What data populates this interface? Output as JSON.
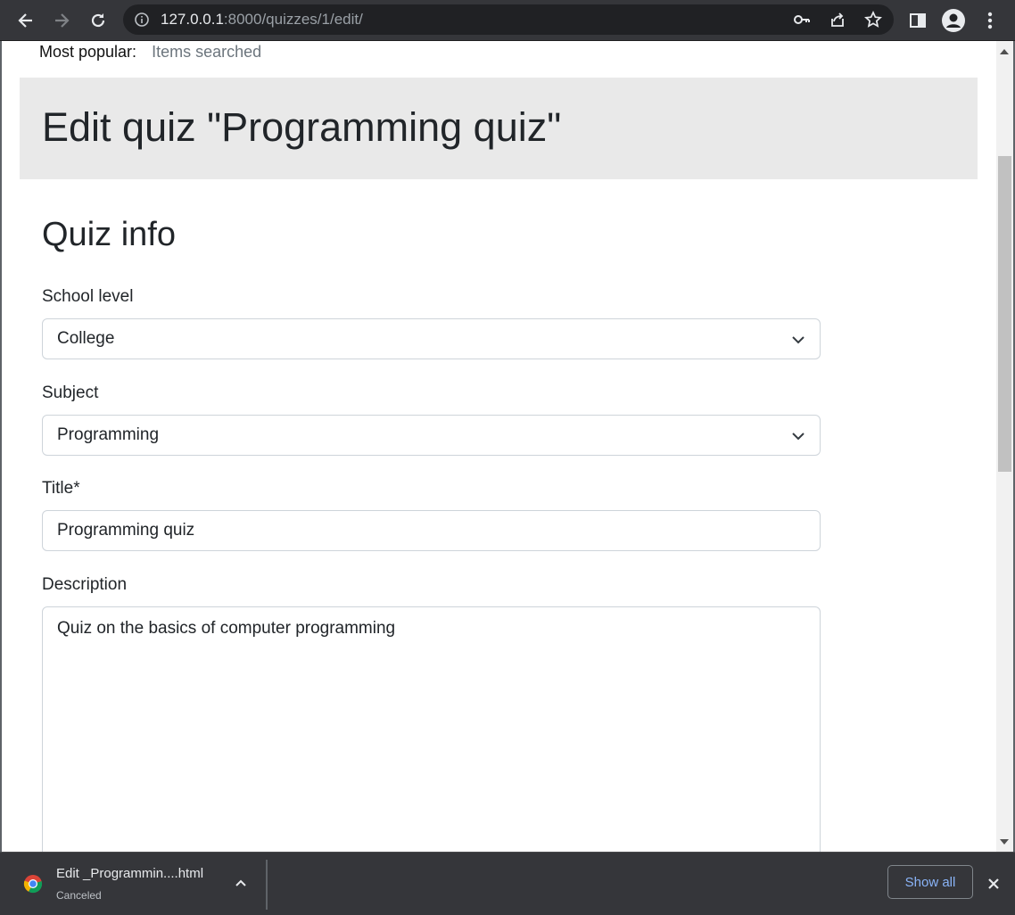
{
  "browser": {
    "url_host": "127.0.0.1",
    "url_rest": ":8000/quizzes/1/edit/"
  },
  "page": {
    "popular_label": "Most popular:",
    "popular_items": "Items searched",
    "heading": "Edit quiz \"Programming quiz\"",
    "section_title": "Quiz info",
    "fields": {
      "school_level": {
        "label": "School level",
        "value": "College"
      },
      "subject": {
        "label": "Subject",
        "value": "Programming"
      },
      "title": {
        "label": "Title*",
        "value": "Programming quiz"
      },
      "description": {
        "label": "Description",
        "value": "Quiz on the basics of computer programming"
      }
    }
  },
  "download_bar": {
    "file_name": "Edit _Programmin....html",
    "status": "Canceled",
    "show_all_label": "Show all"
  },
  "colors": {
    "chrome_bg": "#35363a",
    "omnibox_bg": "#202124",
    "header_band": "#e9e9e9",
    "link_blue": "#8ab4f8"
  }
}
